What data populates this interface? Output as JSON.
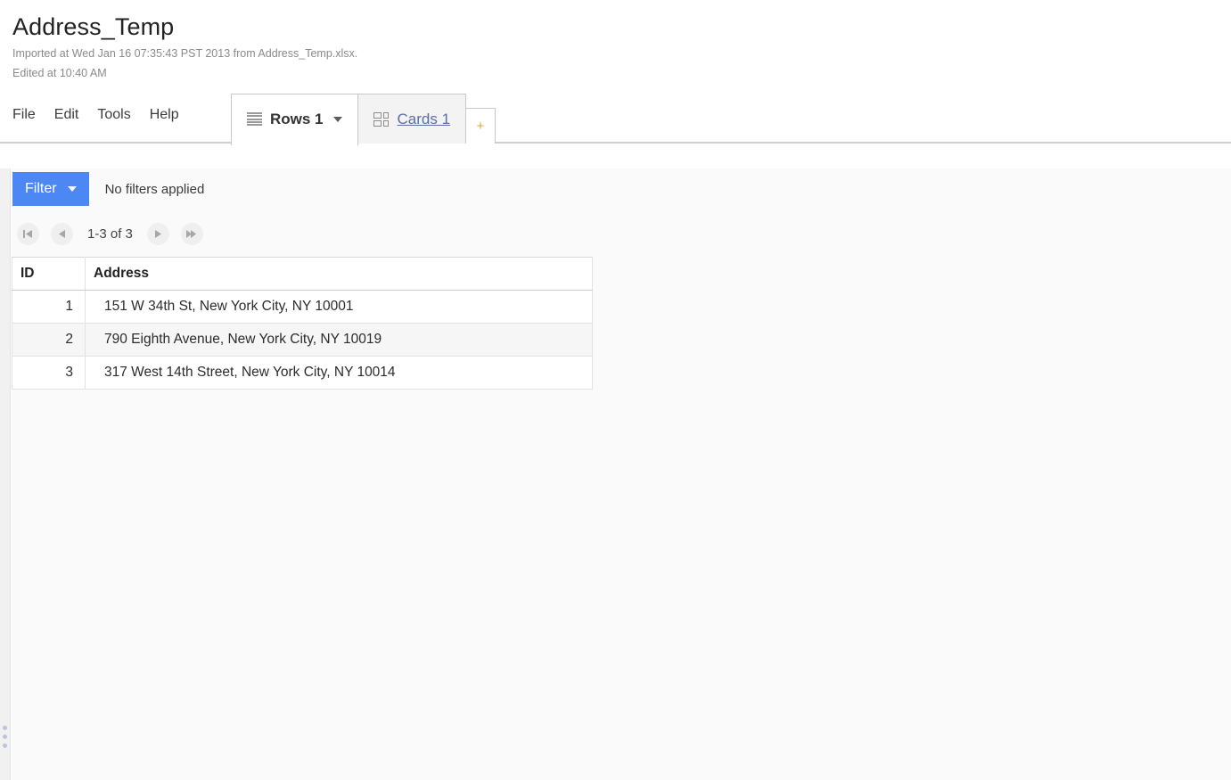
{
  "header": {
    "title": "Address_Temp",
    "imported_line": "Imported at Wed Jan 16 07:35:43 PST 2013 from Address_Temp.xlsx.",
    "edited_line": "Edited at 10:40 AM"
  },
  "menu": {
    "items": [
      {
        "label": "File"
      },
      {
        "label": "Edit"
      },
      {
        "label": "Tools"
      },
      {
        "label": "Help"
      }
    ]
  },
  "tabs": {
    "items": [
      {
        "label": "Rows 1",
        "icon": "rows-icon",
        "active": true,
        "has_caret": true
      },
      {
        "label": "Cards 1",
        "icon": "cards-icon",
        "active": false,
        "has_caret": false
      }
    ],
    "add_label": "+"
  },
  "toolbar": {
    "filter_label": "Filter",
    "filter_status": "No filters applied"
  },
  "pager": {
    "first_icon": "skip-to-first-icon",
    "prev_icon": "previous-icon",
    "range_label": "1-3 of 3",
    "next_icon": "next-icon",
    "last_icon": "skip-to-last-icon"
  },
  "table": {
    "columns": [
      "ID",
      "Address"
    ],
    "rows": [
      {
        "id": "1",
        "address": "151 W 34th St, New York City, NY 10001"
      },
      {
        "id": "2",
        "address": "790 Eighth Avenue, New York City, NY 10019"
      },
      {
        "id": "3",
        "address": "317 West 14th Street, New York City, NY 10014"
      }
    ]
  },
  "colors": {
    "accent_blue": "#4d87f4",
    "link_blue": "#5b6ea8",
    "plus_gold": "#e0a23a",
    "pane_bg": "#fafafa",
    "alt_row": "#f6f6f6"
  }
}
